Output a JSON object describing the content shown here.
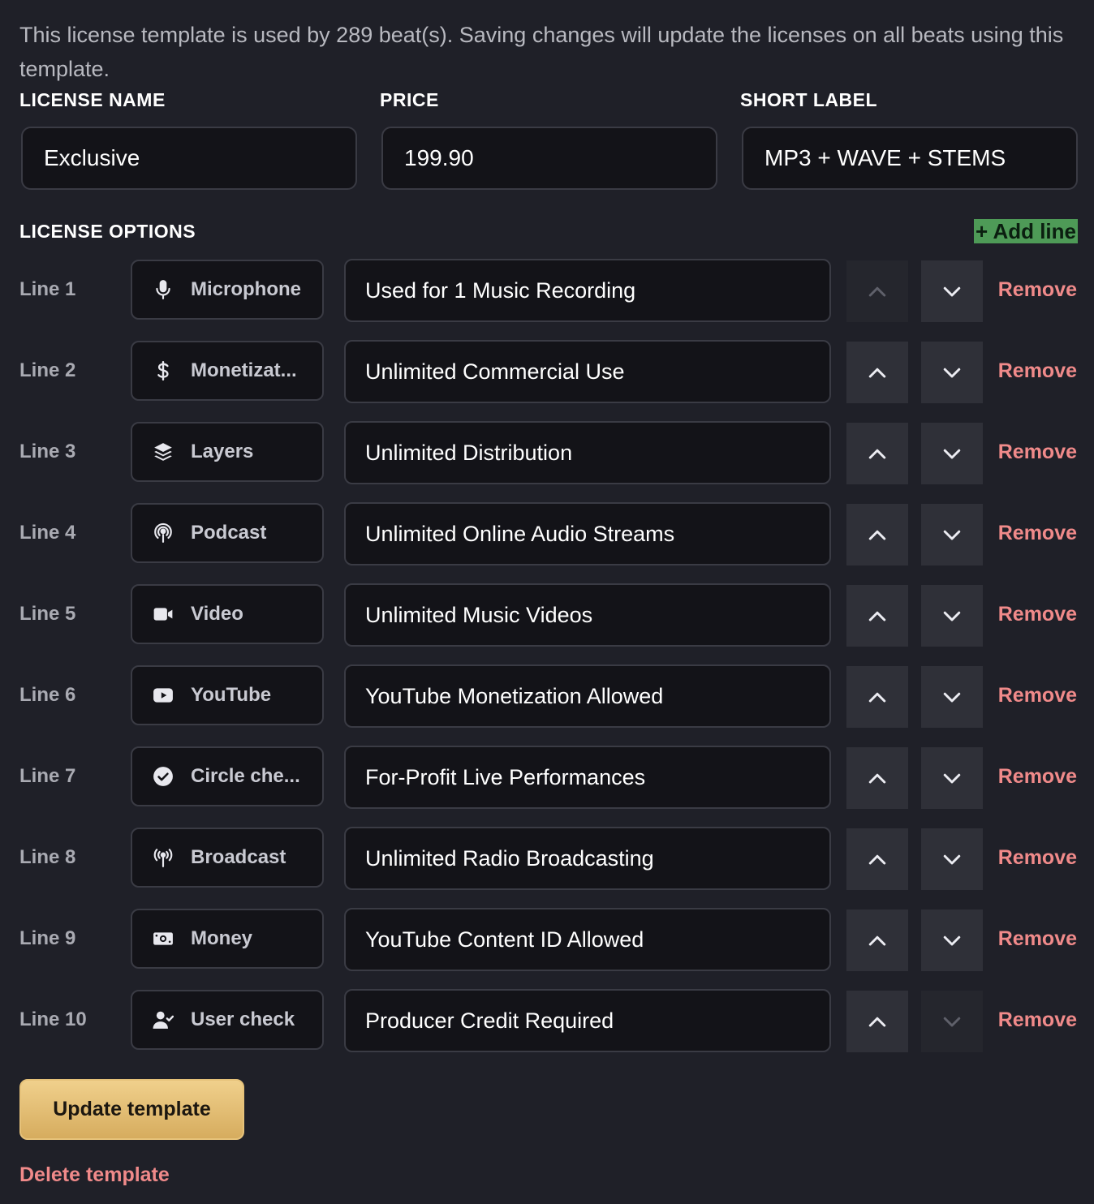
{
  "notice": "This license template is used by 289 beat(s). Saving changes will update the licenses on all beats using this template.",
  "fields": {
    "license_name": {
      "label": "LICENSE NAME",
      "value": "Exclusive"
    },
    "price": {
      "label": "PRICE",
      "value": "199.90"
    },
    "short_label": {
      "label": "SHORT LABEL",
      "value": "MP3 + WAVE + STEMS"
    }
  },
  "options": {
    "title": "LICENSE OPTIONS",
    "add_line_label": "+ Add line",
    "remove_label": "Remove",
    "lines": [
      {
        "label": "Line 1",
        "icon": "microphone-icon",
        "icon_label": "Microphone",
        "text": "Used for 1 Music Recording",
        "up_enabled": false,
        "down_enabled": true
      },
      {
        "label": "Line 2",
        "icon": "dollar-icon",
        "icon_label": "Monetizat...",
        "text": "Unlimited Commercial Use",
        "up_enabled": true,
        "down_enabled": true
      },
      {
        "label": "Line 3",
        "icon": "layers-icon",
        "icon_label": "Layers",
        "text": "Unlimited Distribution",
        "up_enabled": true,
        "down_enabled": true
      },
      {
        "label": "Line 4",
        "icon": "podcast-icon",
        "icon_label": "Podcast",
        "text": "Unlimited Online Audio Streams",
        "up_enabled": true,
        "down_enabled": true
      },
      {
        "label": "Line 5",
        "icon": "video-icon",
        "icon_label": "Video",
        "text": "Unlimited Music Videos",
        "up_enabled": true,
        "down_enabled": true
      },
      {
        "label": "Line 6",
        "icon": "youtube-icon",
        "icon_label": "YouTube",
        "text": "YouTube Monetization Allowed",
        "up_enabled": true,
        "down_enabled": true
      },
      {
        "label": "Line 7",
        "icon": "circle-check-icon",
        "icon_label": "Circle che...",
        "text": "For-Profit Live Performances",
        "up_enabled": true,
        "down_enabled": true
      },
      {
        "label": "Line 8",
        "icon": "broadcast-icon",
        "icon_label": "Broadcast",
        "text": "Unlimited Radio Broadcasting",
        "up_enabled": true,
        "down_enabled": true
      },
      {
        "label": "Line 9",
        "icon": "money-icon",
        "icon_label": "Money",
        "text": "YouTube Content ID Allowed",
        "up_enabled": true,
        "down_enabled": true
      },
      {
        "label": "Line 10",
        "icon": "user-check-icon",
        "icon_label": "User check",
        "text": "Producer Credit Required",
        "up_enabled": true,
        "down_enabled": false
      }
    ]
  },
  "actions": {
    "update_label": "Update template",
    "delete_label": "Delete template"
  },
  "colors": {
    "background": "#1f2028",
    "danger": "#f08a8a",
    "accent_gold": "#e6c27a",
    "add_line_green": "#4e9a57"
  }
}
